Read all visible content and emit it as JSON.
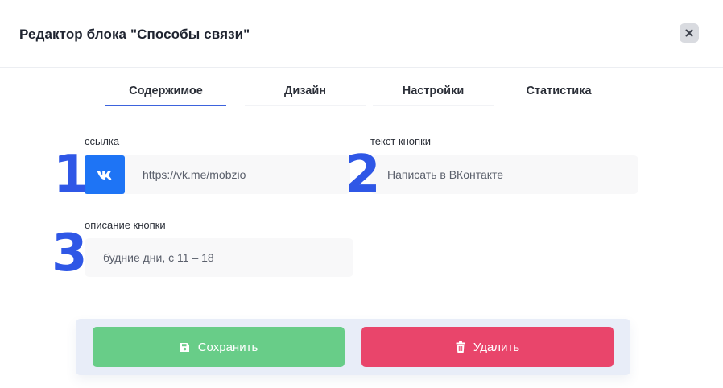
{
  "modal": {
    "title": "Редактор блока \"Способы связи\""
  },
  "tabs": [
    {
      "label": "Содержимое",
      "active": true
    },
    {
      "label": "Дизайн",
      "active": false
    },
    {
      "label": "Настройки",
      "active": false
    },
    {
      "label": "Статистика",
      "active": false
    }
  ],
  "fields": {
    "link": {
      "label": "ссылка",
      "value": "https://vk.me/mobzio",
      "icon": "vk-icon"
    },
    "button_text": {
      "label": "текст кнопки",
      "value": "Написать в ВКонтакте"
    },
    "button_description": {
      "label": "описание кнопки",
      "value": "будние дни, с 11 – 18"
    }
  },
  "annotations": [
    "1",
    "2",
    "3"
  ],
  "actions": {
    "save_label": "Сохранить",
    "delete_label": "Удалить"
  },
  "colors": {
    "accent": "#3d63dd",
    "vk_blue": "#1e74f5",
    "save_green": "#68cd88",
    "delete_red": "#e9456b",
    "annotation_blue": "#2f57e6"
  }
}
